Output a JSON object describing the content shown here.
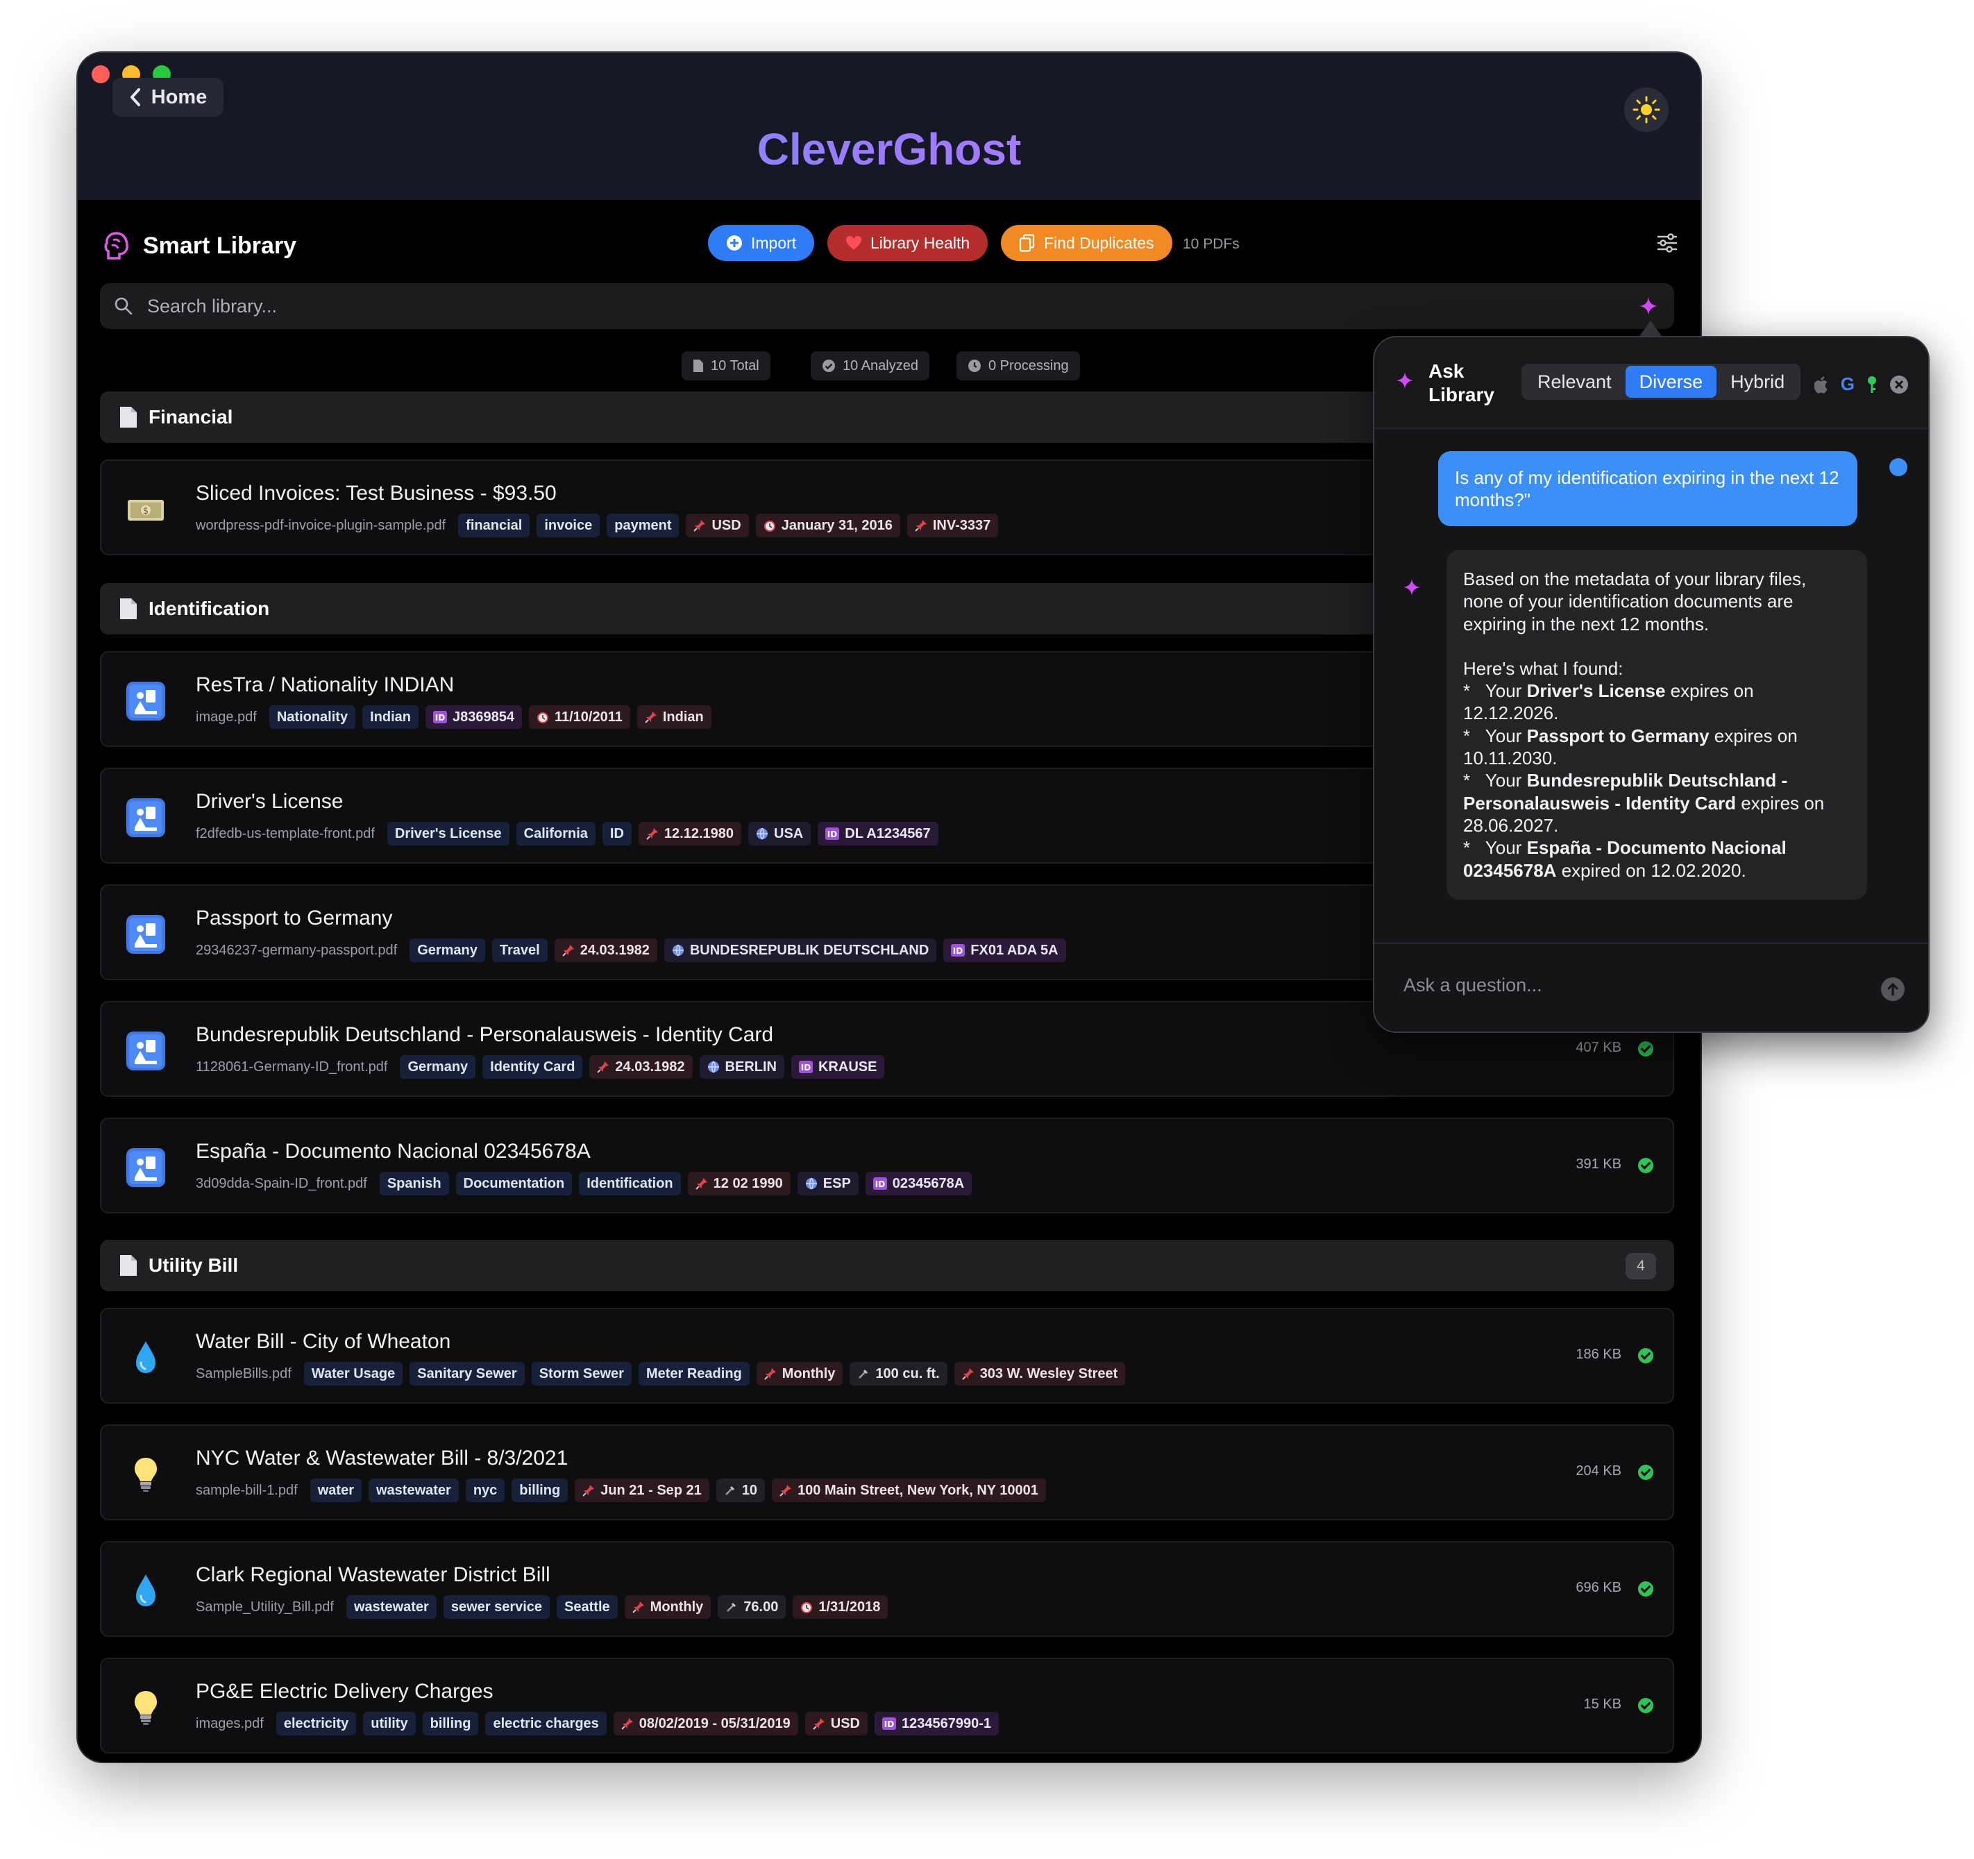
{
  "window": {
    "back_label": "Home",
    "brand": "CleverGhost"
  },
  "header": {
    "title": "Smart Library",
    "import_label": "Import",
    "health_label": "Library Health",
    "duplicates_label": "Find Duplicates",
    "pdf_count": "10 PDFs"
  },
  "search": {
    "placeholder": "Search library..."
  },
  "stats": {
    "total": "10 Total",
    "analyzed": "10 Analyzed",
    "processing": "0 Processing"
  },
  "sections": {
    "financial": {
      "title": "Financial"
    },
    "identification": {
      "title": "Identification"
    },
    "utility": {
      "title": "Utility Bill",
      "count": "4"
    }
  },
  "docs": [
    {
      "title": "Sliced Invoices: Test Business - $93.50",
      "file": "wordpress-pdf-invoice-plugin-sample.pdf",
      "icon": "money-icon",
      "tags": [
        {
          "k": "kw",
          "t": "financial"
        },
        {
          "k": "kw",
          "t": "invoice"
        },
        {
          "k": "kw",
          "t": "payment"
        },
        {
          "k": "pin",
          "t": "USD"
        },
        {
          "k": "cal",
          "t": "January 31, 2016"
        },
        {
          "k": "pin",
          "t": "INV-3337"
        }
      ]
    },
    {
      "title": "ResTra / Nationality INDIAN",
      "file": "image.pdf",
      "icon": "passport-control-icon",
      "tags": [
        {
          "k": "kw",
          "t": "Nationality"
        },
        {
          "k": "kw",
          "t": "Indian"
        },
        {
          "k": "id",
          "t": "J8369854"
        },
        {
          "k": "cal",
          "t": "11/10/2011"
        },
        {
          "k": "pin",
          "t": "Indian"
        }
      ]
    },
    {
      "title": "Driver's License",
      "file": "f2dfedb-us-template-front.pdf",
      "icon": "passport-control-icon",
      "tags": [
        {
          "k": "kw",
          "t": "Driver's License"
        },
        {
          "k": "kw",
          "t": "California"
        },
        {
          "k": "kw",
          "t": "ID"
        },
        {
          "k": "pin",
          "t": "12.12.1980"
        },
        {
          "k": "glob",
          "t": "USA"
        },
        {
          "k": "id",
          "t": "DL A1234567"
        }
      ]
    },
    {
      "title": "Passport to Germany",
      "file": "29346237-germany-passport.pdf",
      "icon": "passport-control-icon",
      "tags": [
        {
          "k": "kw",
          "t": "Germany"
        },
        {
          "k": "kw",
          "t": "Travel"
        },
        {
          "k": "pin",
          "t": "24.03.1982"
        },
        {
          "k": "glob",
          "t": "BUNDESREPUBLIK DEUTSCHLAND"
        },
        {
          "k": "id",
          "t": "FX01 ADA 5A"
        }
      ]
    },
    {
      "title": "Bundesrepublik Deutschland - Personalausweis - Identity Card",
      "file": "1128061-Germany-ID_front.pdf",
      "icon": "passport-control-icon",
      "size": "407 KB",
      "tags": [
        {
          "k": "kw",
          "t": "Germany"
        },
        {
          "k": "kw",
          "t": "Identity Card"
        },
        {
          "k": "pin",
          "t": "24.03.1982"
        },
        {
          "k": "glob",
          "t": "BERLIN"
        },
        {
          "k": "id",
          "t": "KRAUSE"
        }
      ]
    },
    {
      "title": "España - Documento Nacional 02345678A",
      "file": "3d09dda-Spain-ID_front.pdf",
      "icon": "passport-control-icon",
      "size": "391 KB",
      "tags": [
        {
          "k": "kw",
          "t": "Spanish"
        },
        {
          "k": "kw",
          "t": "Documentation"
        },
        {
          "k": "kw",
          "t": "Identification"
        },
        {
          "k": "pin",
          "t": "12 02 1990"
        },
        {
          "k": "glob",
          "t": "ESP"
        },
        {
          "k": "id",
          "t": "02345678A"
        }
      ]
    },
    {
      "title": "Water Bill - City of Wheaton",
      "file": "SampleBills.pdf",
      "icon": "droplet-icon",
      "size": "186 KB",
      "tags": [
        {
          "k": "kw",
          "t": "Water Usage"
        },
        {
          "k": "kw",
          "t": "Sanitary Sewer"
        },
        {
          "k": "kw",
          "t": "Storm Sewer"
        },
        {
          "k": "kw",
          "t": "Meter Reading"
        },
        {
          "k": "pin",
          "t": "Monthly"
        },
        {
          "k": "meter",
          "t": "100 cu. ft."
        },
        {
          "k": "pin",
          "t": "303 W. Wesley Street"
        }
      ]
    },
    {
      "title": "NYC Water & Wastewater Bill - 8/3/2021",
      "file": "sample-bill-1.pdf",
      "icon": "lightbulb-icon",
      "size": "204 KB",
      "tags": [
        {
          "k": "kw",
          "t": "water"
        },
        {
          "k": "kw",
          "t": "wastewater"
        },
        {
          "k": "kw",
          "t": "nyc"
        },
        {
          "k": "kw",
          "t": "billing"
        },
        {
          "k": "pin",
          "t": "Jun 21 - Sep 21"
        },
        {
          "k": "meter",
          "t": "10"
        },
        {
          "k": "pin",
          "t": "100 Main Street, New York, NY 10001"
        }
      ]
    },
    {
      "title": "Clark Regional Wastewater District Bill",
      "file": "Sample_Utility_Bill.pdf",
      "icon": "droplet-icon",
      "size": "696 KB",
      "tags": [
        {
          "k": "kw",
          "t": "wastewater"
        },
        {
          "k": "kw",
          "t": "sewer service"
        },
        {
          "k": "kw",
          "t": "Seattle"
        },
        {
          "k": "pin",
          "t": "Monthly"
        },
        {
          "k": "meter",
          "t": "76.00"
        },
        {
          "k": "cal",
          "t": "1/31/2018"
        }
      ]
    },
    {
      "title": "PG&E Electric Delivery Charges",
      "file": "images.pdf",
      "icon": "lightbulb-icon",
      "size": "15 KB",
      "tags": [
        {
          "k": "kw",
          "t": "electricity"
        },
        {
          "k": "kw",
          "t": "utility"
        },
        {
          "k": "kw",
          "t": "billing"
        },
        {
          "k": "kw",
          "t": "electric charges"
        },
        {
          "k": "pin",
          "t": "08/02/2019 - 05/31/2019"
        },
        {
          "k": "pin",
          "t": "USD"
        },
        {
          "k": "id",
          "t": "1234567990-1"
        }
      ]
    }
  ],
  "chat": {
    "title": "Ask Library",
    "modes": [
      "Relevant",
      "Diverse",
      "Hybrid"
    ],
    "active_mode": "Diverse",
    "user_message": "Is any of my identification expiring in the next 12 months?\"",
    "ai_intro": "Based on the metadata of your library files, none of your identification documents are expiring in the next 12 months.",
    "ai_found": "Here's what I found:",
    "ai_items": [
      {
        "pre": "Your ",
        "bold": "Driver's License",
        "post": " expires on 12.12.2026."
      },
      {
        "pre": "Your ",
        "bold": "Passport to Germany",
        "post": " expires on 10.11.2030."
      },
      {
        "pre": "Your ",
        "bold": "Bundesrepublik Deutschland - Personalausweis - Identity Card",
        "post": " expires on 28.06.2027."
      },
      {
        "pre": "Your ",
        "bold": "España - Documento Nacional 02345678A",
        "post": " expired on 12.02.2020."
      }
    ],
    "input_placeholder": "Ask a question..."
  },
  "colors": {
    "accent": "#2f7cf6",
    "health": "#b32d2d",
    "duplicates": "#f08a24",
    "success": "#30c358"
  }
}
